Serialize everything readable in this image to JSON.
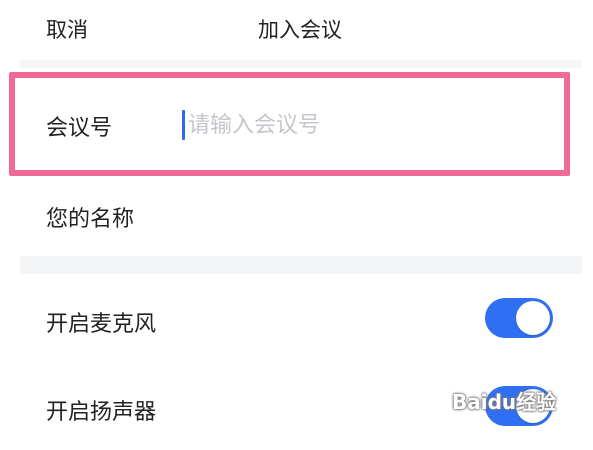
{
  "header": {
    "cancel_label": "取消",
    "title": "加入会议"
  },
  "meeting_id": {
    "label": "会议号",
    "placeholder": "请输入会议号",
    "value": ""
  },
  "name": {
    "label": "您的名称"
  },
  "settings": {
    "mic_label": "开启麦克风",
    "mic_on": true,
    "speaker_label": "开启扬声器",
    "speaker_on": true
  },
  "colors": {
    "accent": "#2f6ff2",
    "highlight_border": "#ef6a96",
    "separator": "#f4f5f7"
  },
  "watermark": "Baidu经验"
}
